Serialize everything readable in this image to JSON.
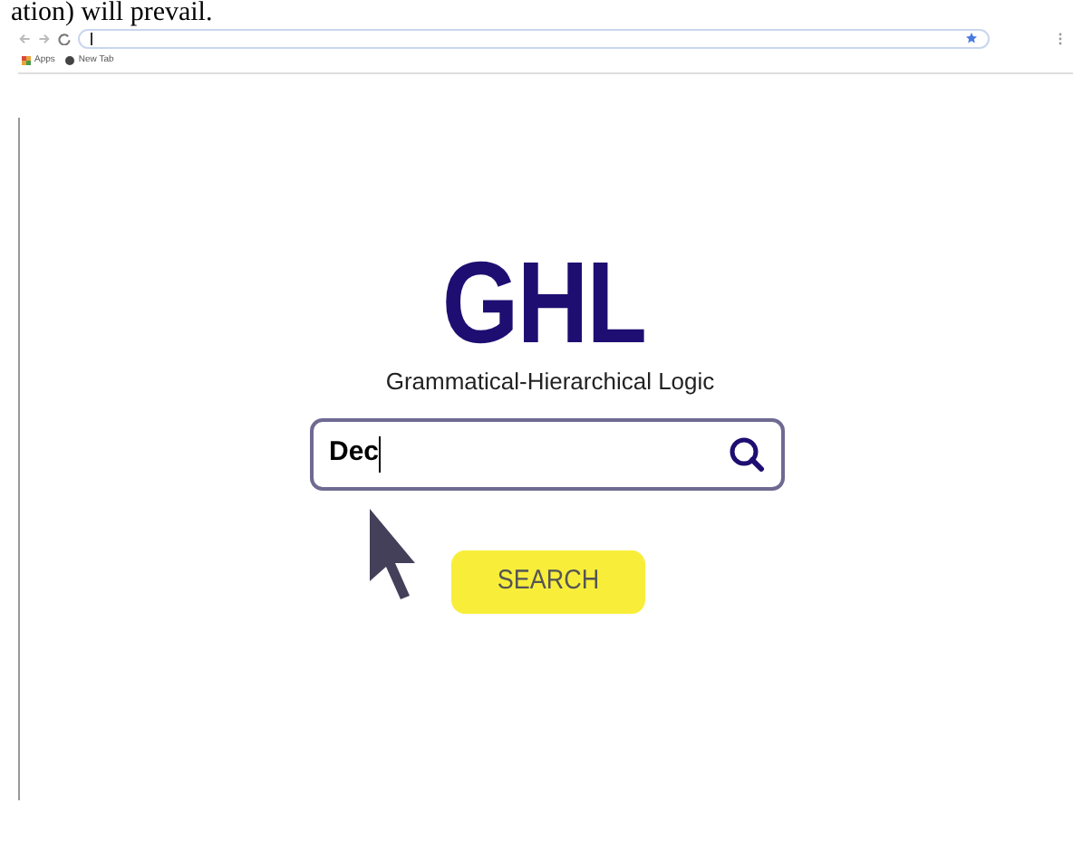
{
  "document_text": "ation) will prevail.",
  "browser": {
    "bookmarks": [
      {
        "label": "Apps",
        "kind": "apps"
      },
      {
        "label": "New Tab",
        "kind": "page"
      }
    ]
  },
  "logo": {
    "title": "GHL",
    "subtitle": "Grammatical-Hierarchical Logic"
  },
  "search_field": {
    "value": "Dec"
  },
  "search_button": {
    "label": "SEARCH"
  }
}
